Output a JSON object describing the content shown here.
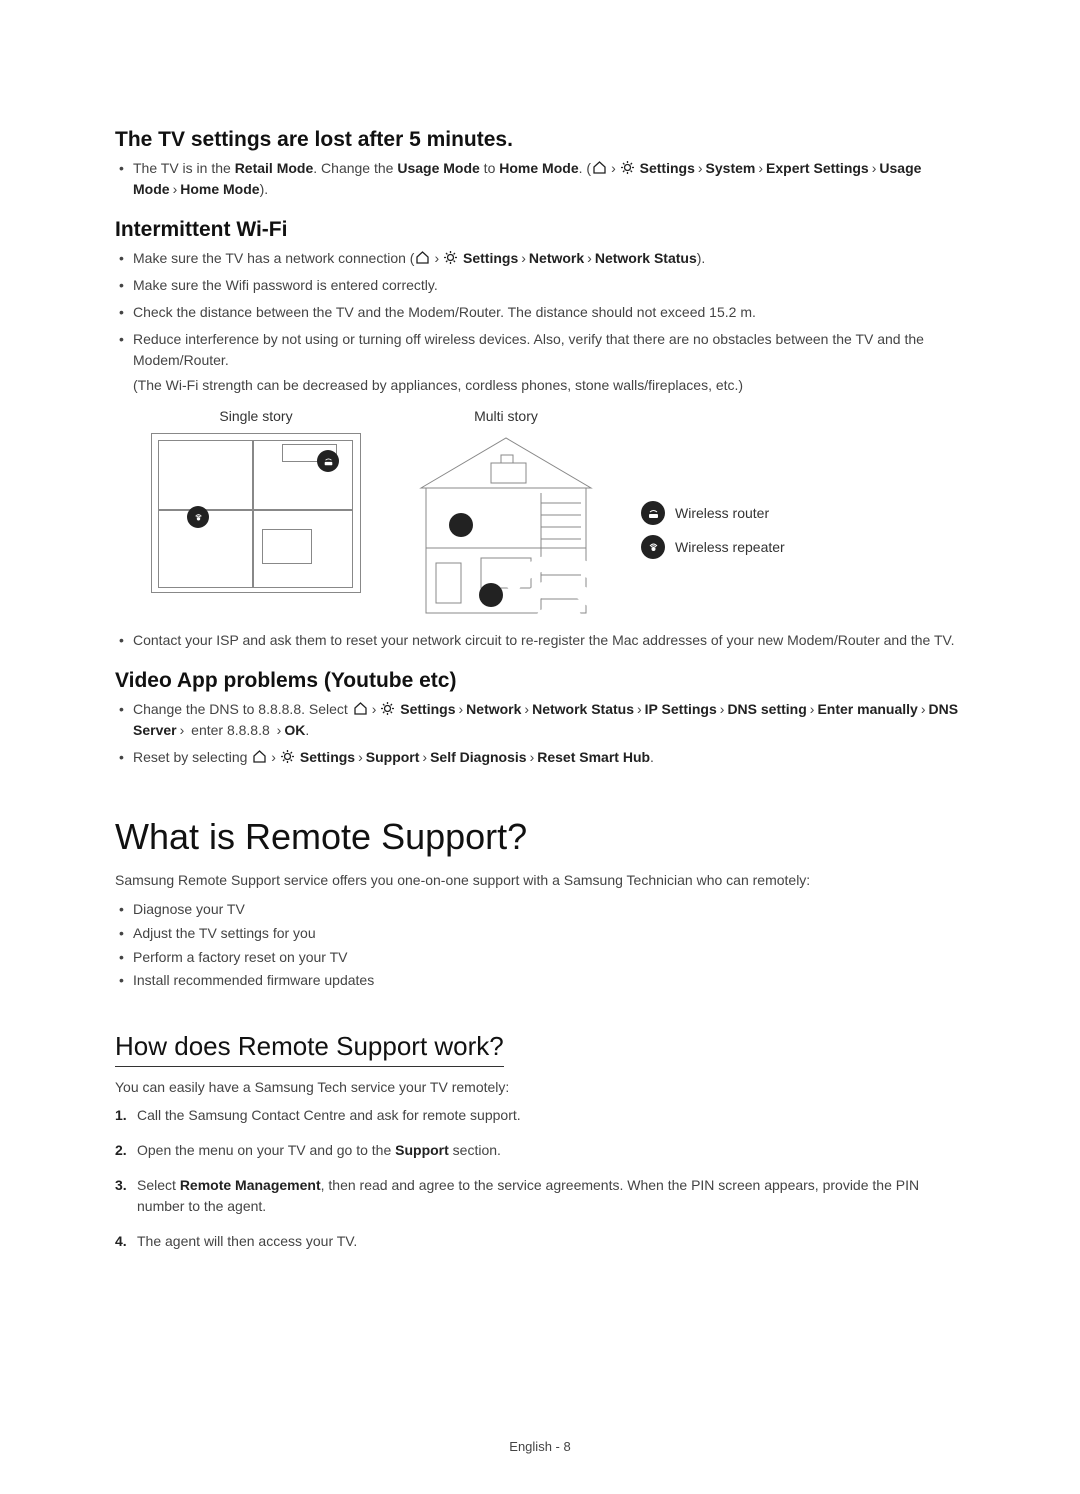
{
  "section1": {
    "heading": "The TV settings are lost after 5 minutes.",
    "bullet1_a": "The TV is in the ",
    "bullet1_b": "Retail Mode",
    "bullet1_c": ". Change the ",
    "bullet1_d": "Usage Mode",
    "bullet1_e": " to ",
    "bullet1_f": "Home Mode",
    "bullet1_g": ". (",
    "bullet1_h": "Settings",
    "bullet1_i": "System",
    "bullet1_j": "Expert Settings",
    "bullet1_k": "Usage Mode",
    "bullet1_l": "Home Mode",
    "bullet1_m": ")."
  },
  "section2": {
    "heading": "Intermittent Wi-Fi",
    "b1_a": "Make sure the TV has a network connection (",
    "b1_b": "Settings",
    "b1_c": "Network",
    "b1_d": "Network Status",
    "b1_e": ").",
    "b2": "Make sure the Wifi password is entered correctly.",
    "b3": "Check the distance between the TV and the Modem/Router. The distance should not exceed 15.2 m.",
    "b4": "Reduce interference by not using or turning off wireless devices. Also, verify that there are no obstacles between the TV and the Modem/Router.",
    "b4_note": "(The Wi-Fi strength can be decreased by appliances, cordless phones, stone walls/fireplaces, etc.)",
    "diagram": {
      "single_label": "Single story",
      "multi_label": "Multi story",
      "legend_router": "Wireless router",
      "legend_repeater": "Wireless repeater"
    },
    "b5": "Contact your ISP and ask them to reset your network circuit to re-register the Mac addresses of your new Modem/Router and the TV."
  },
  "section3": {
    "heading": "Video App problems (Youtube etc)",
    "b1_a": "Change the DNS to 8.8.8.8. Select ",
    "b1_b": "Settings",
    "b1_c": "Network",
    "b1_d": "Network Status",
    "b1_e": "IP Settings",
    "b1_f": "DNS setting",
    "b1_g": "Enter manually",
    "b1_h": "DNS Server",
    "b1_i": " enter 8.8.8.8 ",
    "b1_j": "OK",
    "b1_k": ".",
    "b2_a": "Reset by selecting ",
    "b2_b": "Settings",
    "b2_c": "Support",
    "b2_d": "Self Diagnosis",
    "b2_e": "Reset Smart Hub",
    "b2_f": "."
  },
  "section4": {
    "heading": "What is Remote Support?",
    "intro": "Samsung Remote Support service offers you one-on-one support with a Samsung Technician who can remotely:",
    "items": [
      "Diagnose your TV",
      "Adjust the TV settings for you",
      "Perform a factory reset on your TV",
      "Install recommended firmware updates"
    ]
  },
  "section5": {
    "heading": "How does Remote Support work?",
    "intro": "You can easily have a Samsung Tech service your TV remotely:",
    "steps": {
      "s1": "Call the Samsung Contact Centre and ask for remote support.",
      "s2_a": "Open the menu on your TV and go to the ",
      "s2_b": "Support",
      "s2_c": " section.",
      "s3_a": "Select ",
      "s3_b": "Remote Management",
      "s3_c": ", then read and agree to the service agreements. When the PIN screen appears, provide the PIN number to the agent.",
      "s4": "The agent will then access your TV."
    }
  },
  "footer": "English - 8",
  "nums": {
    "n1": "1.",
    "n2": "2.",
    "n3": "3.",
    "n4": "4."
  },
  "sep": "›"
}
